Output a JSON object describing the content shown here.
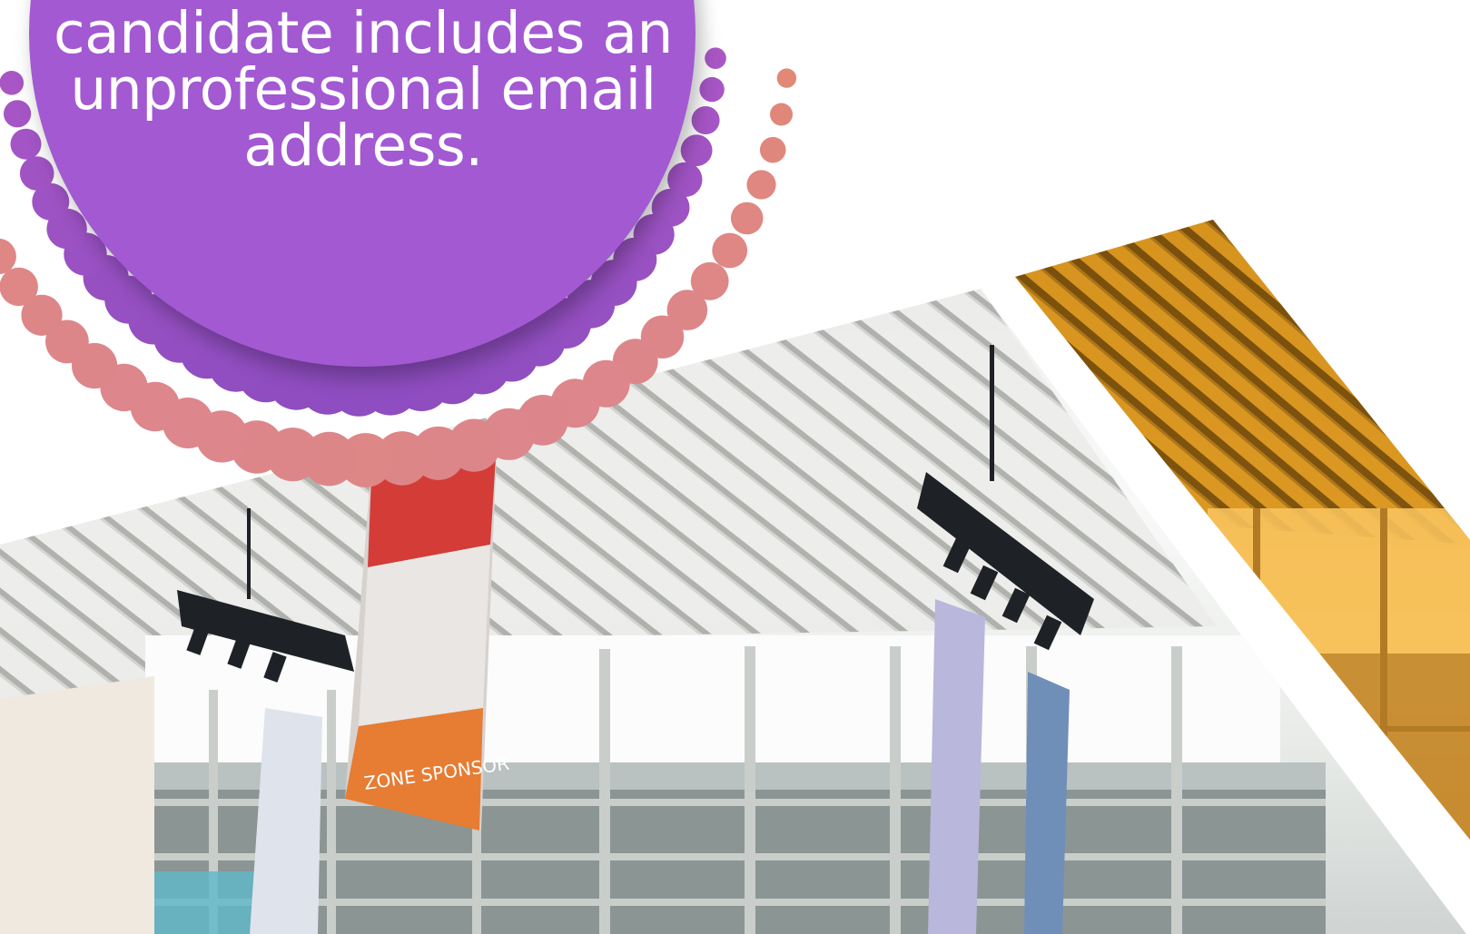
{
  "callout": {
    "lines": [
      "candidate includes an",
      "unprofessional email",
      "address."
    ]
  },
  "photos": [
    {
      "subject": "exhibition hall interior with slatted ceiling, stage lighting trusses and hanging banners"
    },
    {
      "subject": "same ceiling photo with orange color overlay"
    }
  ],
  "banner": {
    "label": "ZONE SPONSOR"
  },
  "colors": {
    "callout": "#a259d2",
    "dots_inner_top": "#b25ac8",
    "dots_outer_top": "#e88a5a",
    "dots_bottom": "#d9859a",
    "overlay": "#f5ab2c"
  }
}
